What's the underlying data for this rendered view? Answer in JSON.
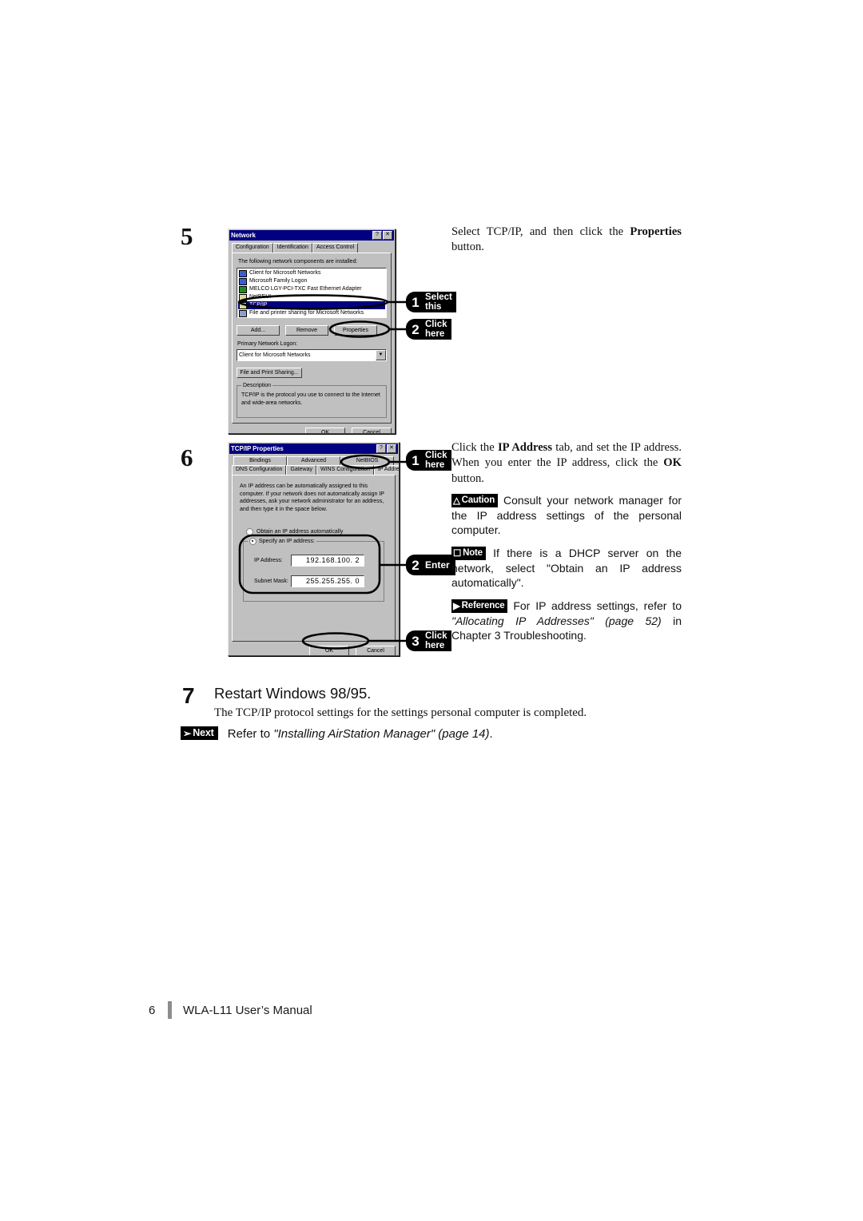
{
  "document": {
    "footer": {
      "page_number": "6",
      "title": "WLA-L11 User’s Manual"
    }
  },
  "steps": [
    {
      "number": "5",
      "text_runs": [
        {
          "t": "Select TCP/IP, and then click the ",
          "b": false
        },
        {
          "t": "Properties",
          "b": true
        },
        {
          "t": " button.",
          "b": false
        }
      ],
      "text_plain": "Select TCP/IP, and then click the Properties button."
    },
    {
      "number": "6",
      "text_runs": [
        {
          "t": "Click the ",
          "b": false
        },
        {
          "t": "IP Address",
          "b": true
        },
        {
          "t": " tab, and set the IP address. When you enter the IP address, click the ",
          "b": false
        },
        {
          "t": "OK",
          "b": true
        },
        {
          "t": " button.",
          "b": false
        }
      ],
      "text_plain": "Click the IP Address tab, and set the IP address. When you enter the IP address, click the OK button."
    },
    {
      "number": "7",
      "heading": "Restart Windows 98/95.",
      "subtext": "The TCP/IP protocol settings for the settings personal computer is completed."
    }
  ],
  "notices": [
    {
      "badge": "Caution",
      "icon": "warning-triangle-icon",
      "text": "Consult your network manager for the IP address settings of the personal computer."
    },
    {
      "badge": "Note",
      "icon": "document-page-icon",
      "text": "If there is a DHCP server on the network, select \"Obtain an IP address automatically\"."
    },
    {
      "badge": "Reference",
      "icon": "right-triangle-icon",
      "runs": [
        {
          "t": "For IP address settings, refer to ",
          "i": false
        },
        {
          "t": "\"Allocating IP Addresses\" (page 52)",
          "i": true
        },
        {
          "t": " in Chapter 3 Troubleshooting.",
          "i": false
        }
      ]
    },
    {
      "badge": "Next",
      "icon": "arrow-next-icon",
      "runs": [
        {
          "t": "Refer to ",
          "i": false
        },
        {
          "t": "\"Installing AirStation Manager\" (page 14)",
          "i": true
        },
        {
          "t": ".",
          "i": false
        }
      ]
    }
  ],
  "callouts": [
    {
      "id": "s5-c1",
      "number": "1",
      "line1": "Select",
      "line2": "this"
    },
    {
      "id": "s5-c2",
      "number": "2",
      "line1": "Click",
      "line2": "here"
    },
    {
      "id": "s6-c1",
      "number": "1",
      "line1": "Click",
      "line2": "here"
    },
    {
      "id": "s6-c2",
      "number": "2",
      "line1": "Enter",
      "line2": ""
    },
    {
      "id": "s6-c3",
      "number": "3",
      "line1": "Click",
      "line2": "here"
    }
  ],
  "network_dialog": {
    "title": "Network",
    "titlebar_buttons": [
      "?",
      "✕"
    ],
    "tabs": [
      "Configuration",
      "Identification",
      "Access Control"
    ],
    "active_tab": "Configuration",
    "list_label": "The following network components are installed:",
    "components": [
      {
        "label": "Client for Microsoft Networks",
        "icon": "network-client-icon",
        "selected": false
      },
      {
        "label": "Microsoft Family Logon",
        "icon": "network-client-icon",
        "selected": false
      },
      {
        "label": "MELCO LGY-PCI-TXC Fast Ethernet Adapter",
        "icon": "network-adapter-icon",
        "selected": false
      },
      {
        "label": "NetBEUI",
        "icon": "protocol-icon",
        "selected": false
      },
      {
        "label": "TCP/IP",
        "icon": "protocol-icon",
        "selected": true
      },
      {
        "label": "File and printer sharing for Microsoft Networks",
        "icon": "file-sharing-icon",
        "selected": false
      }
    ],
    "buttons": {
      "add": "Add...",
      "remove": "Remove",
      "properties": "Properties"
    },
    "logon_label": "Primary Network Logon:",
    "logon_value": "Client for Microsoft Networks",
    "sharing_button": "File and Print Sharing...",
    "description_title": "Description",
    "description_text": "TCP/IP is the protocol you use to connect to the Internet and wide-area networks.",
    "ok": "OK",
    "cancel": "Cancel"
  },
  "tcpip_dialog": {
    "title": "TCP/IP Properties",
    "titlebar_buttons": [
      "?",
      "✕"
    ],
    "tabs_top": [
      "Bindings",
      "Advanced",
      "NetBIOS"
    ],
    "tabs_bottom": [
      "DNS Configuration",
      "Gateway",
      "WINS Configuration",
      "IP Address"
    ],
    "active_tab": "IP Address",
    "description": "An IP address can be automatically assigned to this computer. If your network does not automatically assign IP addresses, ask your network administrator for an address, and then type it in the space below.",
    "radio_auto": "Obtain an IP address automatically",
    "radio_specify": "Specify an IP address:",
    "radio_selected": "specify",
    "ip_label": "IP Address:",
    "ip_value": "192.168.100. 2",
    "subnet_label": "Subnet Mask:",
    "subnet_value": "255.255.255. 0",
    "ok": "OK",
    "cancel": "Cancel"
  },
  "colors": {
    "titlebar": "#000080",
    "dialog_face": "#c0c0c0",
    "selection": "#000080",
    "footer_bar": "#8d8d8d",
    "text": "#111111"
  }
}
